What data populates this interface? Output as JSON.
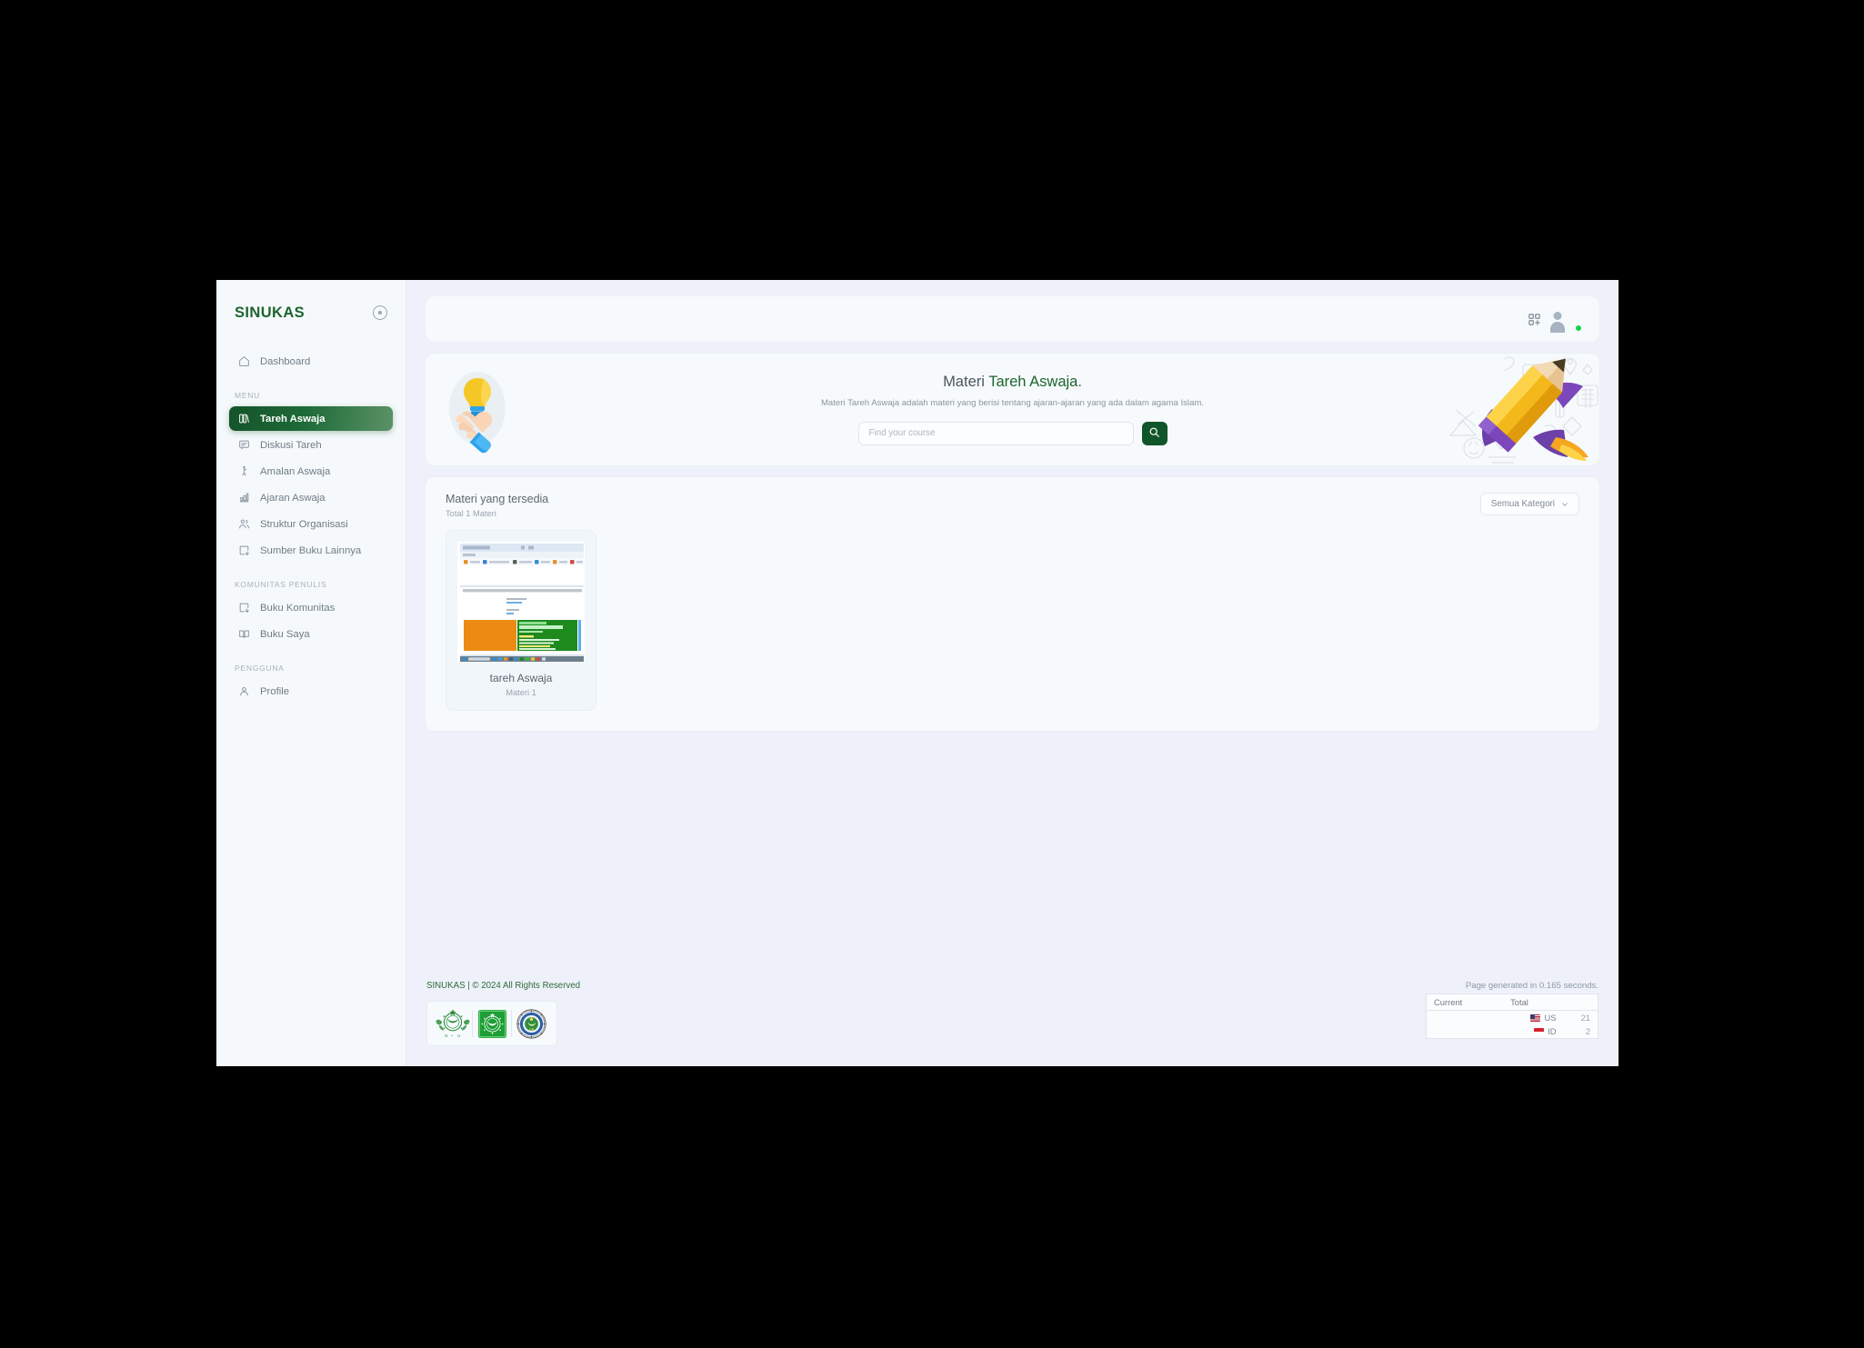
{
  "sidebar": {
    "brand": "SINUKAS",
    "collapse_icon": "circle-dot-icon",
    "dashboard": {
      "label": "Dashboard",
      "icon": "home-icon"
    },
    "sections": [
      {
        "label": "MENU",
        "items": [
          {
            "label": "Tareh Aswaja",
            "icon": "books-icon",
            "active": true
          },
          {
            "label": "Diskusi Tareh",
            "icon": "message-icon",
            "active": false
          },
          {
            "label": "Amalan Aswaja",
            "icon": "praying-icon",
            "active": false
          },
          {
            "label": "Ajaran Aswaja",
            "icon": "chart-icon",
            "active": false
          },
          {
            "label": "Struktur Organisasi",
            "icon": "users-icon",
            "active": false
          },
          {
            "label": "Sumber Buku Lainnya",
            "icon": "download-box-icon",
            "active": false
          }
        ]
      },
      {
        "label": "KOMUNITAS PENULIS",
        "items": [
          {
            "label": "Buku Komunitas",
            "icon": "download-box-icon",
            "active": false
          },
          {
            "label": "Buku Saya",
            "icon": "open-book-icon",
            "active": false
          }
        ]
      },
      {
        "label": "PENGGUNA",
        "items": [
          {
            "label": "Profile",
            "icon": "user-icon",
            "active": false
          }
        ]
      }
    ]
  },
  "topbar": {
    "grid_add_icon": "grid-plus-icon",
    "avatar_icon": "avatar-icon",
    "status": "online"
  },
  "hero": {
    "title_plain": "Materi ",
    "title_accent": "Tareh Aswaja",
    "title_period": ".",
    "subtitle": "Materi Tareh Aswaja adalah materi yang berisi tentang ajaran-ajaran yang ada dalam agama Islam.",
    "search_placeholder": "Find your course",
    "search_value": "",
    "search_icon": "search-icon",
    "left_illustration": "hand-holding-lightbulb-icon",
    "right_illustration": "pencil-rocket-icon"
  },
  "panel": {
    "title": "Materi yang tersedia",
    "subtitle": "Total 1 Materi",
    "category_filter": "Semua Kategori",
    "chevron_icon": "chevron-down-icon",
    "cards": [
      {
        "title": "tareh Aswaja",
        "subtitle": "Materi 1",
        "thumb": "browser-screenshot-thumbnail"
      }
    ]
  },
  "footer": {
    "copyright": "SINUKAS | © 2024 All Rights Reserved",
    "logos": [
      "nu-logo",
      "green-badge-logo",
      "university-seal-logo"
    ],
    "generated": "Page generated in 0.165 seconds.",
    "stats": {
      "headers": [
        "Current",
        "Total"
      ],
      "rows": [
        {
          "flag": "US",
          "country": "US",
          "count": "21"
        },
        {
          "flag": "ID",
          "country": "ID",
          "count": "2"
        }
      ]
    }
  },
  "colors": {
    "brand_green": "#1d6430",
    "active_green": "#15532a",
    "search_btn": "#11552a",
    "page_bg": "#eef1f9",
    "panel_bg": "#f6fafc",
    "online_dot": "#15d24a"
  }
}
